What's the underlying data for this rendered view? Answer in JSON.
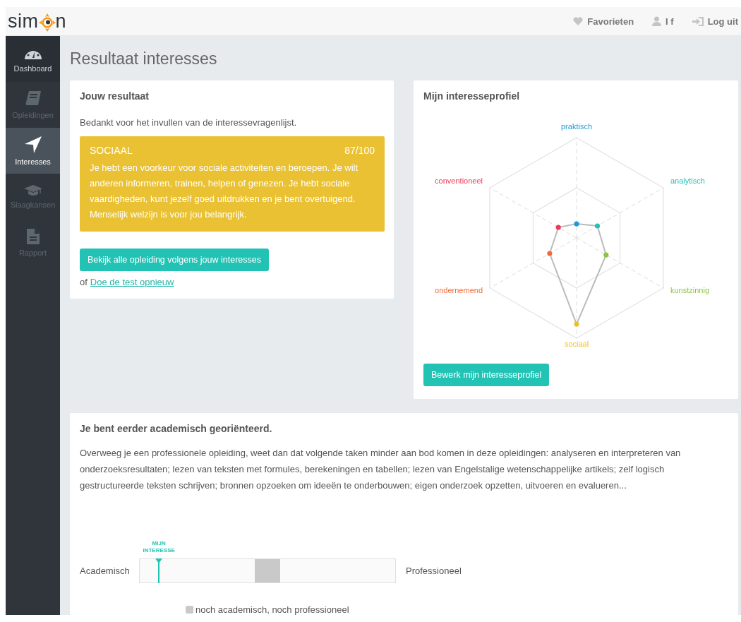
{
  "brand": {
    "logo_start": "sim",
    "logo_end": "n"
  },
  "topbar": {
    "links": [
      {
        "kind": "heart",
        "label": "Favorieten"
      },
      {
        "kind": "user",
        "label": "I f"
      },
      {
        "kind": "logout",
        "label": "Log uit"
      }
    ]
  },
  "sidebar": {
    "items": [
      {
        "kind": "dashboard",
        "label": "Dashboard",
        "selected": false,
        "disabled": false
      },
      {
        "kind": "book",
        "label": "Opleidingen",
        "selected": false,
        "disabled": true
      },
      {
        "kind": "arrow",
        "label": "Interesses",
        "selected": true,
        "disabled": false
      },
      {
        "kind": "cap",
        "label": "Slaagkansen",
        "selected": false,
        "disabled": true
      },
      {
        "kind": "file",
        "label": "Rapport",
        "selected": false,
        "disabled": true
      }
    ]
  },
  "page_title": "Resultaat interesses",
  "result_card": {
    "title": "Jouw resultaat",
    "intro": "Bedankt voor het invullen van de interessevragenlijst.",
    "result": {
      "name": "SOCIAAL",
      "score": "87/100",
      "text": "Je hebt een voorkeur voor sociale activiteiten en beroepen. Je wilt anderen informeren, trainen, helpen of genezen. Je hebt sociale vaardigheden, kunt jezelf goed uitdrukken en je bent overtuigend. Menselijk welzijn is voor jou belangrijk."
    },
    "button": "Bekijk alle opleiding volgens jouw interesses",
    "retry_prefix": "of",
    "retry_link": "Doe de test opnieuw"
  },
  "profile_card": {
    "title": "Mijn interesseprofiel",
    "axes": [
      {
        "label": "praktisch",
        "color": "#1e9ad6"
      },
      {
        "label": "analytisch",
        "color": "#22c3b5"
      },
      {
        "label": "kunstzinnig",
        "color": "#8cc63f"
      },
      {
        "label": "sociaal",
        "color": "#ecc02a"
      },
      {
        "label": "ondernemend",
        "color": "#f26b3a"
      },
      {
        "label": "conventioneel",
        "color": "#ee3a57"
      }
    ],
    "button": "Bewerk mijn interesseprofiel"
  },
  "orientation_card": {
    "title": "Je bent eerder academisch georiënteerd.",
    "text": "Overweeg je een professionele opleiding, weet dan dat volgende taken minder aan bod komen in deze opleidingen: analyseren en interpreteren van onderzoeksresultaten; lezen van teksten met formules, berekeningen en tabellen; lezen van Engelstalige wetenschappelijke artikels; zelf logisch gestructureerde teksten schrijven; bronnen opzoeken om ideeën te onderbouwen; eigen onderzoek opzetten, uitvoeren en evalueren...",
    "scale": {
      "left": "Academisch",
      "right": "Professioneel",
      "marker_label": "MIJN INTERESSE",
      "level": 0.075
    },
    "legend": "noch academisch, noch professioneel"
  }
}
